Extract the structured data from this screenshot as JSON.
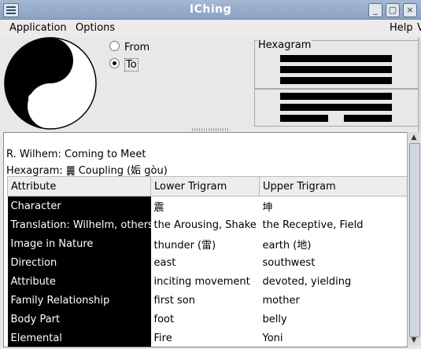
{
  "window": {
    "title": "IChing",
    "controls": [
      "_",
      "▢",
      "×"
    ]
  },
  "menu": {
    "application": "Application",
    "options": "Options",
    "help": "Help",
    "partial": "V"
  },
  "radios": {
    "from": "From",
    "to": "To",
    "selected": "to"
  },
  "hexagram_label": "Hexagram",
  "info": {
    "line1": "R. Wilhem: Coming to Meet",
    "line2": "Hexagram:  ䷫ Coupling (姤  gòu)"
  },
  "table": {
    "headers": [
      "Attribute",
      "Lower Trigram",
      "Upper Trigram"
    ],
    "rows": [
      [
        "Character",
        "震",
        "坤"
      ],
      [
        "Translation: Wilhelm, others",
        "the Arousing, Shake",
        "the Receptive, Field"
      ],
      [
        "Image in Nature",
        "thunder (雷)",
        "earth (地)"
      ],
      [
        "Direction",
        "east",
        "southwest"
      ],
      [
        "Attribute",
        "inciting movement",
        "devoted, yielding"
      ],
      [
        "Family Relationship",
        "first son",
        "mother"
      ],
      [
        "Body Part",
        "foot",
        "belly"
      ],
      [
        "Elemental",
        "Fire",
        "Yoni"
      ]
    ]
  }
}
